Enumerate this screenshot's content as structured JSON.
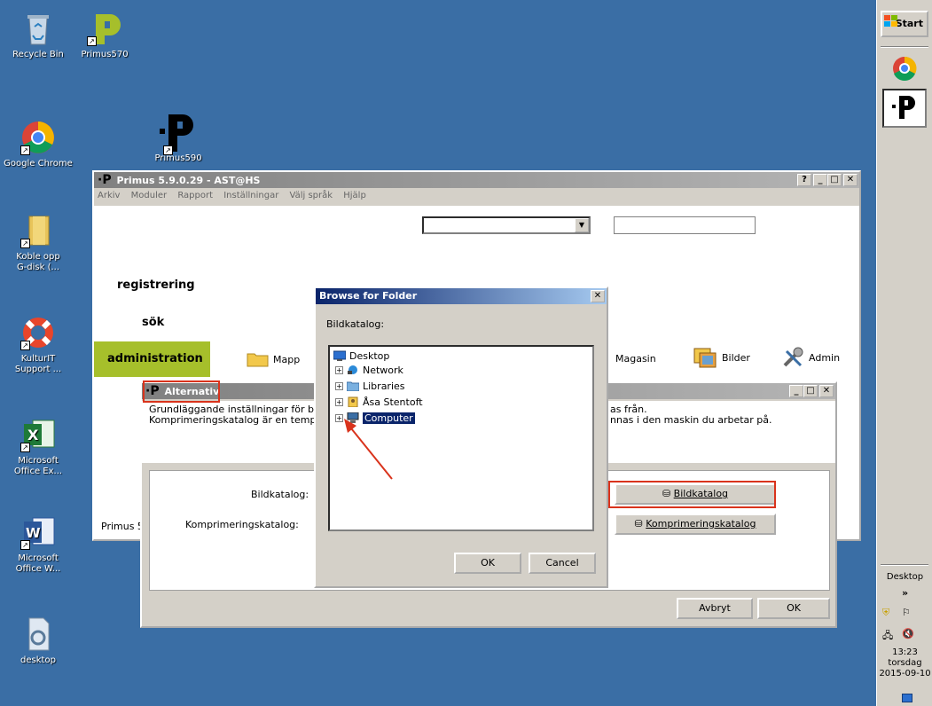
{
  "desktop_icons": [
    {
      "label": "Recycle Bin",
      "icon": "recycle-bin-icon"
    },
    {
      "label": "Primus570",
      "icon": "primus-icon"
    },
    {
      "label": "Google Chrome",
      "icon": "chrome-icon"
    },
    {
      "label": "Primus590",
      "icon": "primus-icon"
    },
    {
      "label": "Koble opp G-disk (...",
      "icon": "folder-icon"
    },
    {
      "label": "KulturIT Support ...",
      "icon": "lifebuoy-icon"
    },
    {
      "label": "Microsoft Office Ex...",
      "icon": "excel-icon"
    },
    {
      "label": "Microsoft Office W...",
      "icon": "word-icon"
    },
    {
      "label": "desktop",
      "icon": "file-icon"
    }
  ],
  "taskbar": {
    "start_label": "Start",
    "desktop_label": "Desktop",
    "chevron": "»",
    "clock_time": "13:23",
    "clock_day": "torsdag",
    "clock_date": "2015-09-10"
  },
  "primus_window": {
    "title": "Primus 5.9.0.29 - AST@HS",
    "menu": [
      "Arkiv",
      "Moduler",
      "Rapport",
      "Inställningar",
      "Välj språk",
      "Hjälp"
    ],
    "nav": {
      "registrering": "registrering",
      "sok": "sök",
      "administration": "administration"
    },
    "toolbar": {
      "mapp": "Mapp",
      "magasin": "Magasin",
      "bilder": "Bilder",
      "admin": "Admin"
    },
    "status_text": "Primus 5"
  },
  "alternativ_dialog": {
    "title": "Alternativ",
    "desc_line1_left": "Grundläggande inställningar för b",
    "desc_line1_right": "as från.",
    "desc_line2_left": "Komprimeringskatalog är en tempo",
    "desc_line2_right": "nnas i den maskin du arbetar på.",
    "bildkatalog_label": "Bildkatalog:",
    "komprimering_label": "Komprimeringskatalog:",
    "bildkatalog_button": "Bildkatalog",
    "komprimering_button": "Komprimeringskatalog",
    "cancel_button": "Avbryt",
    "ok_button": "OK"
  },
  "browse_dialog": {
    "title": "Browse for Folder",
    "prompt": "Bildkatalog:",
    "tree": [
      {
        "label": "Desktop",
        "icon": "desktop-icon",
        "level": 0
      },
      {
        "label": "Network",
        "icon": "network-icon",
        "level": 1
      },
      {
        "label": "Libraries",
        "icon": "libraries-icon",
        "level": 1
      },
      {
        "label": "Åsa Stentoft",
        "icon": "user-folder-icon",
        "level": 1
      },
      {
        "label": "Computer",
        "icon": "computer-icon",
        "level": 1,
        "selected": true
      }
    ],
    "ok_button": "OK",
    "cancel_button": "Cancel"
  },
  "colors": {
    "desktop_bg": "#3a6ea5",
    "admin_tab": "#a6bf2b",
    "annotation_red": "#d9331c",
    "selection": "#0a246a"
  }
}
